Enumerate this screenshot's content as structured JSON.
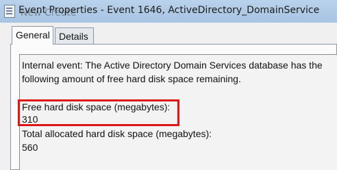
{
  "window": {
    "title": "Event Properties - Event 1646, ActiveDirectory_DomainService",
    "ghost_text": "New Create"
  },
  "tabs": [
    {
      "label": "General",
      "selected": true
    },
    {
      "label": "Details",
      "selected": false
    }
  ],
  "description": {
    "line1": "Internal event: The Active Directory Domain Services database has the",
    "line2": "following amount of free hard disk space remaining.",
    "free_label": "Free hard disk space (megabytes):",
    "free_value": "310",
    "total_label": "Total allocated hard disk space (megabytes):",
    "total_value": "560"
  },
  "colors": {
    "highlight": "#e01515",
    "titlebar": "#b9d1ea"
  },
  "icons": [
    "event-viewer-icon"
  ]
}
